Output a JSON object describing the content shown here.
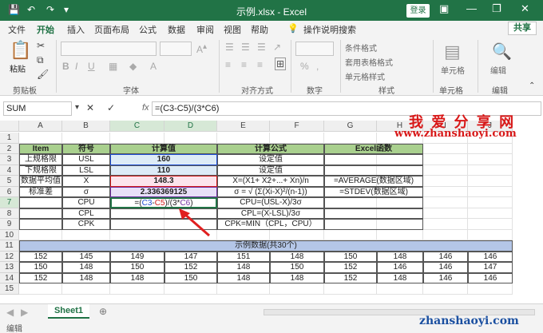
{
  "window": {
    "title": "示例.xlsx - Excel",
    "login": "登录",
    "ribbon_display": "▣",
    "minimize": "—",
    "restore": "❐",
    "close": "✕"
  },
  "qat": {
    "save": "💾",
    "undo": "↶",
    "redo": "↷",
    "more": "▾"
  },
  "tabs": [
    "文件",
    "开始",
    "插入",
    "页面布局",
    "公式",
    "数据",
    "审阅",
    "视图",
    "帮助"
  ],
  "active_tab": "开始",
  "tellme": "操作说明搜索",
  "share": "共享",
  "ribbon": {
    "groups": [
      "剪贴板",
      "字体",
      "对齐方式",
      "数字",
      "样式",
      "单元格",
      "编辑"
    ],
    "paste": "粘贴",
    "number_format": "%",
    "styles": [
      "条件格式",
      "套用表格格式",
      "单元格样式"
    ],
    "cells": "单元格",
    "editing": "编辑"
  },
  "formula_bar": {
    "name_box": "SUM",
    "formula": "=(C3-C5)/(3*C6)",
    "cancel": "✕",
    "enter": "✓",
    "fx": "fx"
  },
  "columns": [
    "A",
    "B",
    "C",
    "D",
    "E",
    "F",
    "G",
    "H",
    "I",
    "J"
  ],
  "rows": [
    "1",
    "2",
    "3",
    "4",
    "5",
    "6",
    "7",
    "8",
    "9",
    "10",
    "11",
    "12",
    "13",
    "14",
    "15"
  ],
  "table": {
    "headers": [
      "Item",
      "符号",
      "计算值",
      "计算公式",
      "Excel函数"
    ],
    "rows": [
      {
        "item": "上规格限",
        "sym": "USL",
        "val": "160",
        "formula": "设定值",
        "func": ""
      },
      {
        "item": "下规格限",
        "sym": "LSL",
        "val": "110",
        "formula": "设定值",
        "func": ""
      },
      {
        "item": "数据平均值",
        "sym": "X",
        "val": "148.3",
        "formula": "X=(X1+ X2+...+ Xn)/n",
        "func": "=AVERAGE(数据区域)"
      },
      {
        "item": "标准差",
        "sym": "σ",
        "val": "2.336369125",
        "formula": "σ = √ (Σ(Xi-X)²/(n-1))",
        "func": "=STDEV(数据区域)"
      },
      {
        "item": "",
        "sym": "CPU",
        "val": "=(C3-C5)/(3*C6)",
        "formula": "CPU=(USL-X)/3σ",
        "func": ""
      },
      {
        "item": "",
        "sym": "CPL",
        "val": "",
        "formula": "CPL=(X-LSL)/3σ",
        "func": ""
      },
      {
        "item": "",
        "sym": "CPK",
        "val": "",
        "formula": "CPK=MIN（CPL，CPU）",
        "func": ""
      }
    ],
    "edit_parts": [
      "=(",
      "C3",
      "-",
      "C5",
      ")/(3*",
      "C6",
      ")"
    ]
  },
  "sample": {
    "title": "示例数据(共30个)",
    "rows": [
      [
        "152",
        "145",
        "149",
        "147",
        "151",
        "148",
        "150",
        "148",
        "146",
        "146"
      ],
      [
        "150",
        "148",
        "150",
        "152",
        "148",
        "150",
        "152",
        "146",
        "146",
        "147"
      ],
      [
        "152",
        "148",
        "148",
        "150",
        "148",
        "148",
        "152",
        "148",
        "146",
        "146"
      ]
    ]
  },
  "sheet": {
    "name": "Sheet1",
    "add": "⊕"
  },
  "status": {
    "mode": "编辑"
  },
  "watermark": {
    "text": "我 爱 分 享 网",
    "url": "www.zhanshaoyi.com",
    "bottom_url": "zhanshaoyi.com"
  },
  "colors": {
    "accent": "#217346",
    "header_fill": "#a9d08e",
    "cell_ref_blue": "#1f4fd6",
    "cell_ref_red": "#d11a1a",
    "cell_ref_purple": "#7030a0",
    "watermark_red": "#d81818"
  }
}
